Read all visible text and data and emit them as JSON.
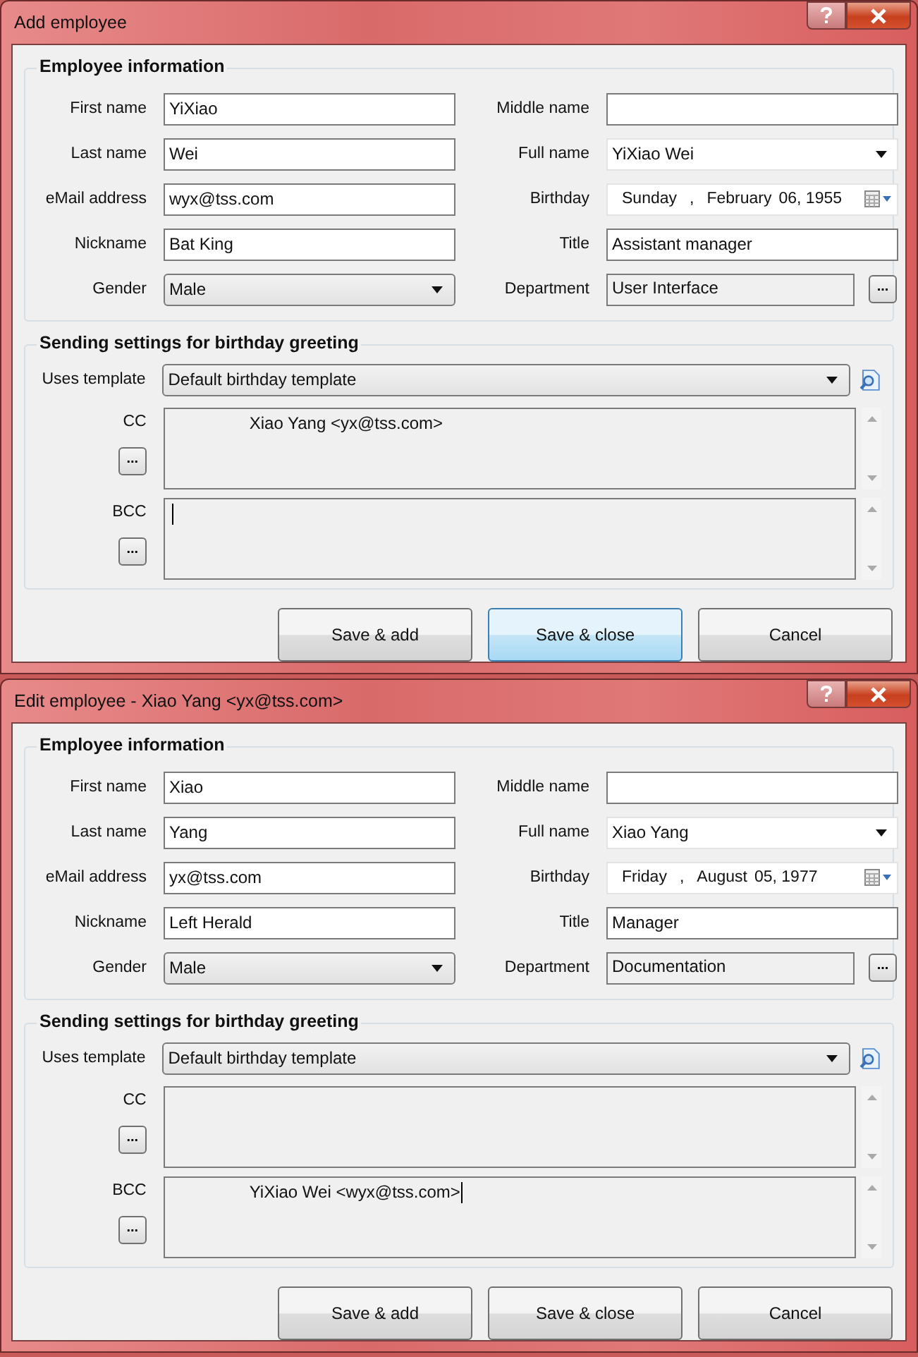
{
  "dialogs": [
    {
      "title": "Add employee",
      "employee_info": {
        "heading": "Employee information",
        "rows": [
          {
            "left": {
              "label": "First name",
              "kind": "text",
              "value": "YiXiao"
            },
            "right": {
              "label": "Middle name",
              "kind": "text"
            }
          },
          {
            "left": {
              "label": "Last name",
              "kind": "text",
              "value": "Wei"
            },
            "right": {
              "label": "Full name",
              "kind": "combo",
              "value": "YiXiao Wei"
            }
          },
          {
            "left": {
              "label": "eMail address",
              "kind": "text",
              "value": "wyx@tss.com"
            },
            "right": {
              "label": "Birthday",
              "kind": "date",
              "parts": [
                "Sunday",
                ",",
                "February",
                "06, 1955"
              ]
            }
          },
          {
            "left": {
              "label": "Nickname",
              "kind": "text",
              "value": "Bat King"
            },
            "right": {
              "label": "Title",
              "kind": "text",
              "value": "Assistant manager"
            }
          },
          {
            "left": {
              "label": "Gender",
              "kind": "select",
              "value": "Male"
            },
            "right": {
              "label": "Department",
              "kind": "browse",
              "value": "User Interface",
              "button": "..."
            }
          }
        ]
      },
      "sending": {
        "heading": "Sending settings for birthday greeting",
        "template_label": "Uses template",
        "template_value": "Default birthday template",
        "lists": [
          {
            "label": "CC",
            "button": "...",
            "value": "Xiao Yang <yx@tss.com>",
            "focused": false
          },
          {
            "label": "BCC",
            "button": "...",
            "focused": true
          }
        ]
      },
      "buttons": [
        {
          "label": "Save & add",
          "default": false
        },
        {
          "label": "Save & close",
          "default": true
        },
        {
          "label": "Cancel",
          "default": false
        }
      ]
    },
    {
      "title": "Edit employee - Xiao Yang <yx@tss.com>",
      "employee_info": {
        "heading": "Employee information",
        "rows": [
          {
            "left": {
              "label": "First name",
              "kind": "text",
              "value": "Xiao"
            },
            "right": {
              "label": "Middle name",
              "kind": "text"
            }
          },
          {
            "left": {
              "label": "Last name",
              "kind": "text",
              "value": "Yang"
            },
            "right": {
              "label": "Full name",
              "kind": "combo",
              "value": "Xiao Yang"
            }
          },
          {
            "left": {
              "label": "eMail address",
              "kind": "text",
              "value": "yx@tss.com"
            },
            "right": {
              "label": "Birthday",
              "kind": "date",
              "parts": [
                "Friday",
                ",",
                "August",
                "05, 1977"
              ]
            }
          },
          {
            "left": {
              "label": "Nickname",
              "kind": "text",
              "value": "Left Herald"
            },
            "right": {
              "label": "Title",
              "kind": "text",
              "value": "Manager"
            }
          },
          {
            "left": {
              "label": "Gender",
              "kind": "select",
              "value": "Male"
            },
            "right": {
              "label": "Department",
              "kind": "browse",
              "value": "Documentation",
              "button": "..."
            }
          }
        ]
      },
      "sending": {
        "heading": "Sending settings for birthday greeting",
        "template_label": "Uses template",
        "template_value": "Default birthday template",
        "lists": [
          {
            "label": "CC",
            "button": "...",
            "focused": false
          },
          {
            "label": "BCC",
            "button": "...",
            "value": "YiXiao Wei <wyx@tss.com>",
            "focused": true
          }
        ]
      },
      "buttons": [
        {
          "label": "Save & add",
          "default": false
        },
        {
          "label": "Save & close",
          "default": false
        },
        {
          "label": "Cancel",
          "default": false
        }
      ]
    }
  ]
}
